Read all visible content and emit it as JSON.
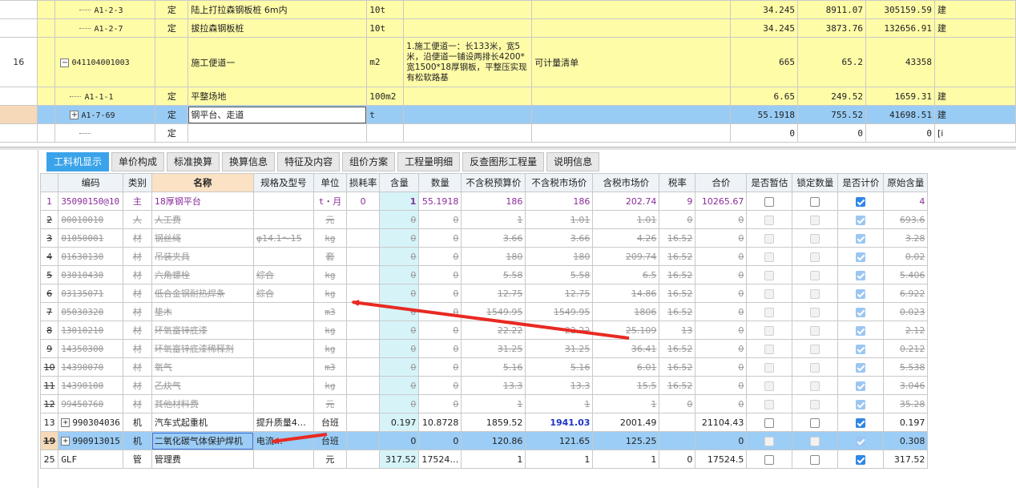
{
  "top_rows": [
    {
      "rn": "",
      "code": "A1-2-3",
      "type": "定",
      "name": "陆上打拉森钢板桩 6m内",
      "unit": "10t",
      "desc": "",
      "extra": "",
      "qty": "34.245",
      "price": "8911.07",
      "total": "305159.59",
      "last": "建",
      "level": 2
    },
    {
      "rn": "",
      "code": "A1-2-7",
      "type": "定",
      "name": "拔拉森钢板桩",
      "unit": "10t",
      "desc": "",
      "extra": "",
      "qty": "34.245",
      "price": "3873.76",
      "total": "132656.91",
      "last": "建",
      "level": 2
    },
    {
      "rn": "16",
      "code": "041104001003",
      "type": "",
      "name": "施工便道一",
      "unit": "m2",
      "desc": "1.施工便道一：长133米，宽5米，沿便道一铺设两排长4200*宽1500*18厚钢板，平整压实现有松软路基",
      "extra": "可计量清单",
      "qty": "665",
      "price": "65.2",
      "total": "43358",
      "last": "",
      "level": 1
    },
    {
      "rn": "",
      "code": "A1-1-1",
      "type": "定",
      "name": "平整场地",
      "unit": "100m2",
      "desc": "",
      "extra": "",
      "qty": "6.65",
      "price": "249.52",
      "total": "1659.31",
      "last": "建",
      "level": 2
    },
    {
      "rn": "",
      "code": "A1-7-69",
      "type": "定",
      "name": "钢平台、走道",
      "unit": "t",
      "desc": "",
      "extra": "",
      "qty": "55.1918",
      "price": "755.52",
      "total": "41698.51",
      "last": "建",
      "level": 2
    },
    {
      "rn": "",
      "code": "",
      "type": "定",
      "name": "",
      "unit": "",
      "desc": "",
      "extra": "",
      "qty": "0",
      "price": "0",
      "total": "0",
      "last": "[i",
      "level": 2
    }
  ],
  "tabs": [
    "工料机显示",
    "单价构成",
    "标准换算",
    "换算信息",
    "特征及内容",
    "组价方案",
    "工程量明细",
    "反查图形工程量",
    "说明信息"
  ],
  "headers": [
    "编码",
    "类别",
    "名称",
    "规格及型号",
    "单位",
    "损耗率",
    "含量",
    "数量",
    "不含税预算价",
    "不含税市场价",
    "含税市场价",
    "税率",
    "合价",
    "是否暂估",
    "锁定数量",
    "是否计价",
    "原始含量"
  ],
  "rows": [
    {
      "rn": "1",
      "code": "35090150@10",
      "cat": "主",
      "name": "18厚钢平台",
      "spec": "",
      "unit": "t・月",
      "loss": "0",
      "content": "1",
      "qty": "55.1918",
      "budget": "186",
      "market": "186",
      "taxmarket": "202.74",
      "tax": "9",
      "total": "10265.67",
      "est": false,
      "lock": false,
      "priced": true,
      "orig": "4",
      "style": "purple"
    },
    {
      "rn": "2",
      "code": "00010010",
      "cat": "人",
      "name": "人工费",
      "spec": "",
      "unit": "元",
      "loss": "",
      "content": "0",
      "qty": "0",
      "budget": "1",
      "market": "1.01",
      "taxmarket": "1.01",
      "tax": "0",
      "total": "0",
      "est": false,
      "lock": false,
      "priced": true,
      "orig": "693.6",
      "style": "struck"
    },
    {
      "rn": "3",
      "code": "01050001",
      "cat": "材",
      "name": "钢丝绳",
      "spec": "φ14.1～15",
      "unit": "kg",
      "loss": "",
      "content": "0",
      "qty": "0",
      "budget": "3.66",
      "market": "3.66",
      "taxmarket": "4.26",
      "tax": "16.52",
      "total": "0",
      "est": false,
      "lock": false,
      "priced": true,
      "orig": "3.28",
      "style": "struck"
    },
    {
      "rn": "4",
      "code": "01630130",
      "cat": "材",
      "name": "吊装夹具",
      "spec": "",
      "unit": "套",
      "loss": "",
      "content": "0",
      "qty": "0",
      "budget": "180",
      "market": "180",
      "taxmarket": "209.74",
      "tax": "16.52",
      "total": "0",
      "est": false,
      "lock": false,
      "priced": true,
      "orig": "0.02",
      "style": "struck"
    },
    {
      "rn": "5",
      "code": "03010430",
      "cat": "材",
      "name": "六角螺栓",
      "spec": "综合",
      "unit": "kg",
      "loss": "",
      "content": "0",
      "qty": "0",
      "budget": "5.58",
      "market": "5.58",
      "taxmarket": "6.5",
      "tax": "16.52",
      "total": "0",
      "est": false,
      "lock": false,
      "priced": true,
      "orig": "5.406",
      "style": "struck"
    },
    {
      "rn": "6",
      "code": "03135071",
      "cat": "材",
      "name": "低合金钢耐热焊条",
      "spec": "综合",
      "unit": "kg",
      "loss": "",
      "content": "0",
      "qty": "0",
      "budget": "12.75",
      "market": "12.75",
      "taxmarket": "14.86",
      "tax": "16.52",
      "total": "0",
      "est": false,
      "lock": false,
      "priced": true,
      "orig": "6.922",
      "style": "struck"
    },
    {
      "rn": "7",
      "code": "05030320",
      "cat": "材",
      "name": "垫木",
      "spec": "",
      "unit": "m3",
      "loss": "",
      "content": "0",
      "qty": "0",
      "budget": "1549.95",
      "market": "1549.95",
      "taxmarket": "1806",
      "tax": "16.52",
      "total": "0",
      "est": false,
      "lock": false,
      "priced": true,
      "orig": "0.023",
      "style": "struck"
    },
    {
      "rn": "8",
      "code": "13010210",
      "cat": "材",
      "name": "环氧富锌底漆",
      "spec": "",
      "unit": "kg",
      "loss": "",
      "content": "0",
      "qty": "0",
      "budget": "22.22",
      "market": "22.22",
      "taxmarket": "25.109",
      "tax": "13",
      "total": "0",
      "est": false,
      "lock": false,
      "priced": true,
      "orig": "2.12",
      "style": "struck"
    },
    {
      "rn": "9",
      "code": "14350300",
      "cat": "材",
      "name": "环氧富锌底漆稀释剂",
      "spec": "",
      "unit": "kg",
      "loss": "",
      "content": "0",
      "qty": "0",
      "budget": "31.25",
      "market": "31.25",
      "taxmarket": "36.41",
      "tax": "16.52",
      "total": "0",
      "est": false,
      "lock": false,
      "priced": true,
      "orig": "0.212",
      "style": "struck"
    },
    {
      "rn": "10",
      "code": "14390070",
      "cat": "材",
      "name": "氧气",
      "spec": "",
      "unit": "m3",
      "loss": "",
      "content": "0",
      "qty": "0",
      "budget": "5.16",
      "market": "5.16",
      "taxmarket": "6.01",
      "tax": "16.52",
      "total": "0",
      "est": false,
      "lock": false,
      "priced": true,
      "orig": "5.538",
      "style": "struck"
    },
    {
      "rn": "11",
      "code": "14390100",
      "cat": "材",
      "name": "乙炔气",
      "spec": "",
      "unit": "kg",
      "loss": "",
      "content": "0",
      "qty": "0",
      "budget": "13.3",
      "market": "13.3",
      "taxmarket": "15.5",
      "tax": "16.52",
      "total": "0",
      "est": false,
      "lock": false,
      "priced": true,
      "orig": "3.046",
      "style": "struck"
    },
    {
      "rn": "12",
      "code": "99450760",
      "cat": "材",
      "name": "其他材料费",
      "spec": "",
      "unit": "元",
      "loss": "",
      "content": "0",
      "qty": "0",
      "budget": "1",
      "market": "1",
      "taxmarket": "1",
      "tax": "0",
      "total": "0",
      "est": false,
      "lock": false,
      "priced": true,
      "orig": "35.28",
      "style": "struck"
    },
    {
      "rn": "13",
      "code": "990304036",
      "cat": "机",
      "name": "汽车式起重机",
      "spec": "提升质量4…",
      "unit": "台班",
      "loss": "",
      "content": "0.197",
      "qty": "10.8728",
      "budget": "1859.52",
      "market": "1941.03",
      "taxmarket": "2001.49",
      "tax": "",
      "total": "21104.43",
      "est": false,
      "lock": false,
      "priced": true,
      "orig": "0.197",
      "style": "normal",
      "toggle": true
    },
    {
      "rn": "19",
      "code": "990913015",
      "cat": "机",
      "name": "二氧化碳气体保护焊机",
      "spec": "电流…",
      "unit": "台班",
      "loss": "",
      "content": "0",
      "qty": "0",
      "budget": "120.86",
      "market": "121.65",
      "taxmarket": "125.25",
      "tax": "",
      "total": "0",
      "est": false,
      "lock": false,
      "priced": true,
      "orig": "0.308",
      "style": "sel",
      "toggle": true
    },
    {
      "rn": "25",
      "code": "GLF",
      "cat": "管",
      "name": "管理费",
      "spec": "",
      "unit": "元",
      "loss": "",
      "content": "317.52",
      "qty": "17524…",
      "budget": "1",
      "market": "1",
      "taxmarket": "1",
      "tax": "0",
      "total": "17524.5",
      "est": false,
      "lock": false,
      "priced": true,
      "orig": "317.52",
      "style": "normal"
    }
  ],
  "colors": {
    "active_tab": "#3aa3ea",
    "selection": "#9bcdf6",
    "row_yellow": "#fffca8",
    "arrow": "#e82a22"
  }
}
